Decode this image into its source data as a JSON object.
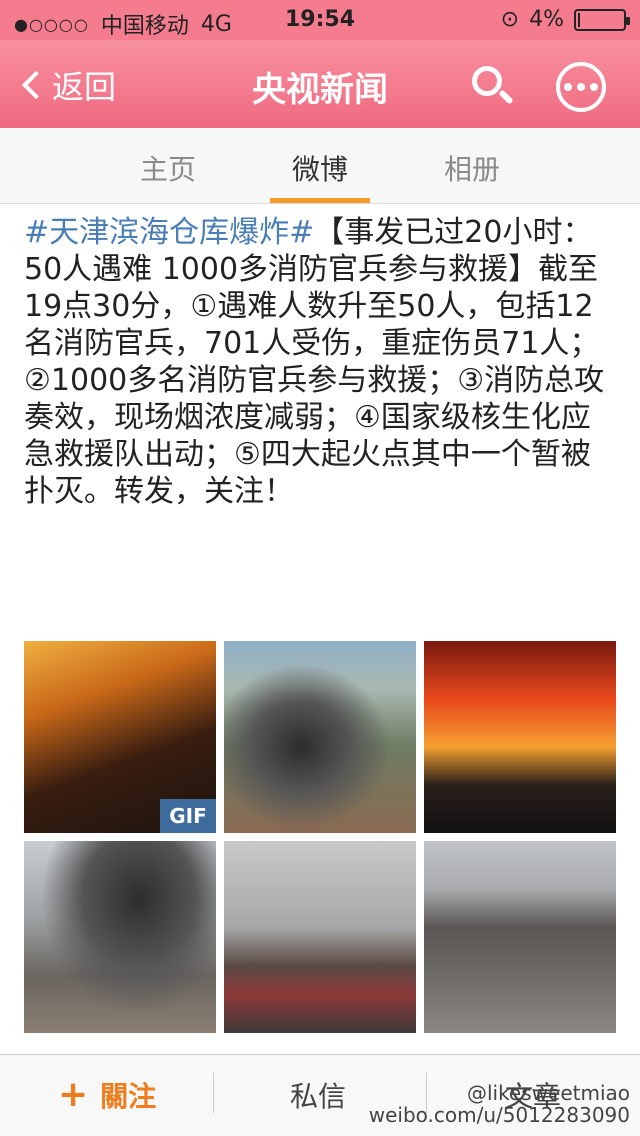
{
  "status_bar": {
    "signal_dots": "●○○○○",
    "carrier": "中国移动",
    "network": "4G",
    "time": "19:54",
    "battery_pct": "4%",
    "battery_level": 0.04
  },
  "nav": {
    "back_label": "返回",
    "title": "央视新闻"
  },
  "tabs": [
    {
      "label": "主页"
    },
    {
      "label": "微博",
      "active": true
    },
    {
      "label": "相册"
    }
  ],
  "post": {
    "hashtag": "#天津滨海仓库爆炸#",
    "text": "【事发已过20小时：50人遇难 1000多消防官兵参与救援】截至19点30分，①遇难人数升至50人，包括12名消防官兵，701人受伤，重症伤员71人；②1000多名消防官兵参与救援；③消防总攻奏效，现场烟浓度减弱；④国家级核生化应急救援队出动；⑤四大起火点其中一个暂被扑灭。转发，关注！"
  },
  "images": [
    {
      "badge": "GIF"
    },
    {},
    {},
    {},
    {},
    {}
  ],
  "bottom_bar": {
    "follow_icon": "+",
    "follow_label": "關注",
    "dm_label": "私信",
    "article_label": "文章"
  },
  "watermark": {
    "line1": "@likesweetmiao",
    "line2": "weibo.com/u/5012283090"
  },
  "colors": {
    "nav_pink": "#f06a80",
    "accent_orange": "#f07d1d",
    "hashtag_blue": "#4a7fb5",
    "tab_underline": "#f39a2b"
  }
}
